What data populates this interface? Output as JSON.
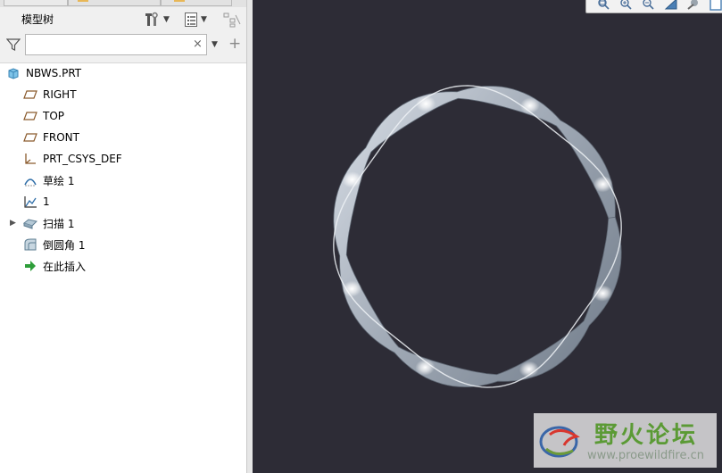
{
  "model_tree": {
    "title": "模型树",
    "filter_placeholder": "",
    "clear_glyph": "×",
    "add_glyph": "+",
    "items": [
      {
        "label": "NBWS.PRT",
        "icon": "part-icon",
        "expandable": false
      },
      {
        "label": "RIGHT",
        "icon": "datum-plane-icon",
        "expandable": false
      },
      {
        "label": "TOP",
        "icon": "datum-plane-icon",
        "expandable": false
      },
      {
        "label": "FRONT",
        "icon": "datum-plane-icon",
        "expandable": false
      },
      {
        "label": "PRT_CSYS_DEF",
        "icon": "coordinate-system-icon",
        "expandable": false
      },
      {
        "label": "草绘 1",
        "icon": "sketch-icon",
        "expandable": false
      },
      {
        "label": "1",
        "icon": "graph-icon",
        "expandable": false
      },
      {
        "label": "扫描 1",
        "icon": "sweep-icon",
        "expandable": true
      },
      {
        "label": "倒圆角 1",
        "icon": "round-icon",
        "expandable": false
      },
      {
        "label": "在此插入",
        "icon": "insert-here-arrow-icon",
        "expandable": false
      }
    ]
  },
  "viewport": {
    "background": "#2d2c36",
    "toolbar_icons": [
      "refit-icon",
      "zoom-in-icon",
      "zoom-out-icon",
      "repaint-icon",
      "display-style-icon",
      "named-view-icon"
    ]
  },
  "watermark": {
    "title": "野火论坛",
    "url": "www.proewildfire.cn"
  },
  "colors": {
    "panel_bg": "#f0f0f0",
    "tree_bg": "#ffffff",
    "model_metal": "#a3acb8",
    "watermark_green": "#5b9a35"
  }
}
